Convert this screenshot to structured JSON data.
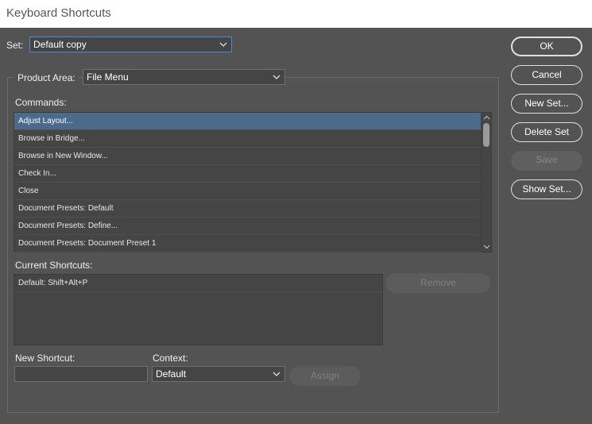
{
  "window": {
    "title": "Keyboard Shortcuts"
  },
  "set": {
    "label": "Set:",
    "value": "Default copy"
  },
  "product_area": {
    "label": "Product Area:",
    "value": "File Menu"
  },
  "commands": {
    "label": "Commands:",
    "items": [
      "Adjust Layout...",
      "Browse in Bridge...",
      "Browse in New Window...",
      "Check In...",
      "Close",
      "Document Presets: Default",
      "Document Presets: Define...",
      "Document Presets: Document Preset 1"
    ],
    "selected_index": 0
  },
  "current_shortcuts": {
    "label": "Current Shortcuts:",
    "items": [
      "Default: Shift+Alt+P"
    ],
    "remove_label": "Remove"
  },
  "new_shortcut": {
    "label": "New Shortcut:",
    "value": ""
  },
  "context": {
    "label": "Context:",
    "value": "Default"
  },
  "assign_label": "Assign",
  "buttons": {
    "ok": "OK",
    "cancel": "Cancel",
    "new_set": "New Set...",
    "delete_set": "Delete Set",
    "save": "Save",
    "show_set": "Show Set..."
  },
  "icons": {
    "dropdown": "chevron-down-icon",
    "scroll_up": "scroll-up-arrow-icon",
    "scroll_down": "scroll-down-arrow-icon"
  }
}
